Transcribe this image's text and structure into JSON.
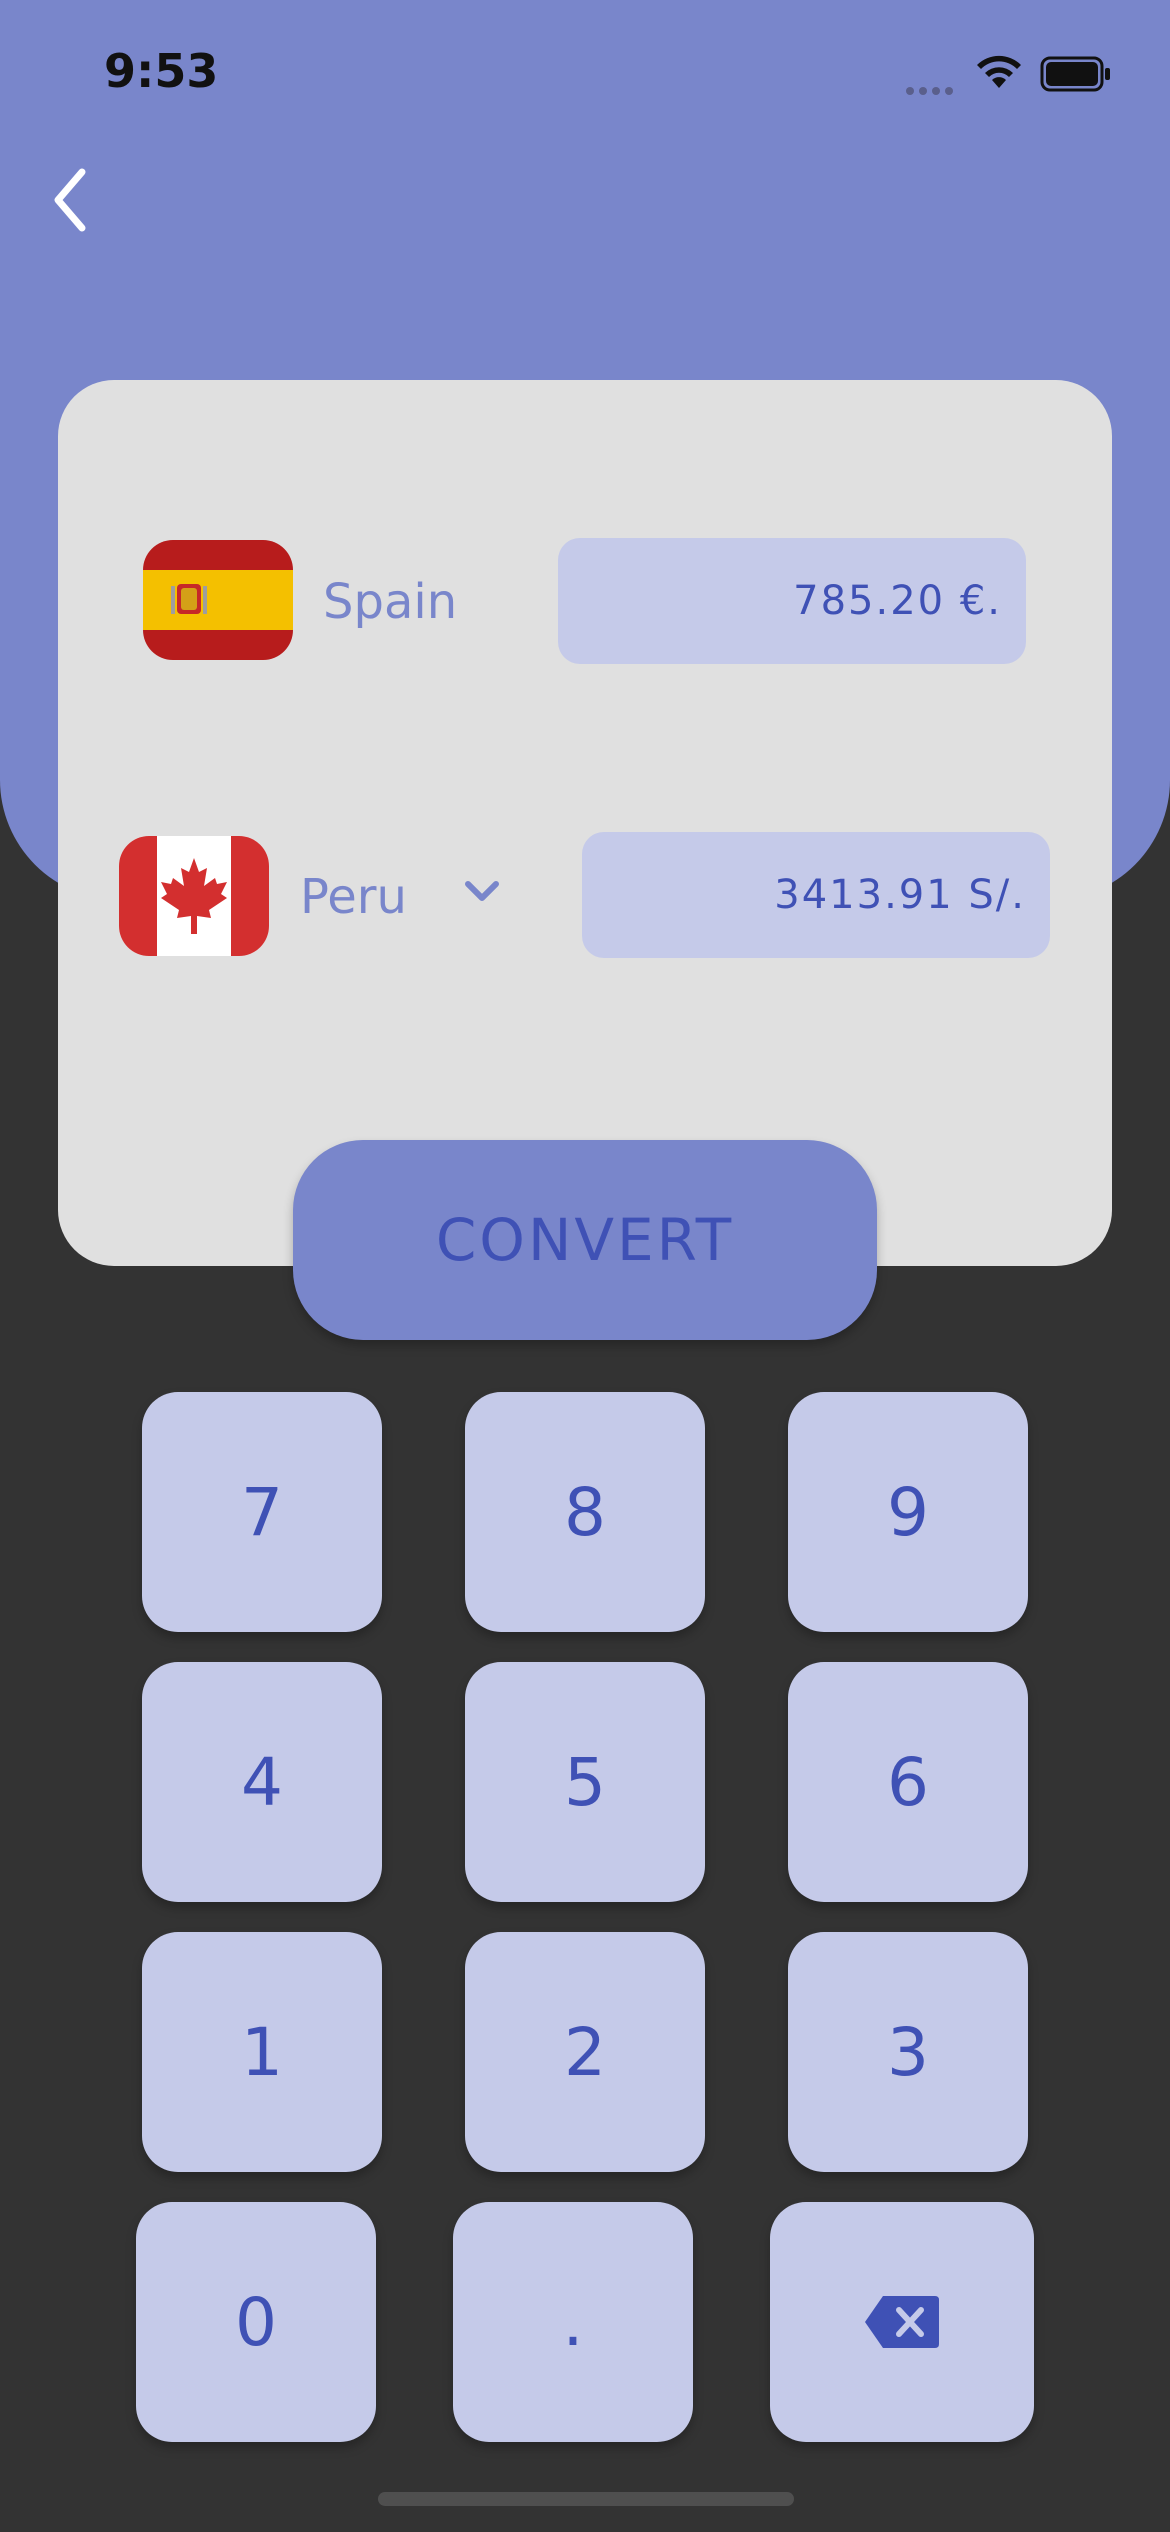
{
  "status_bar": {
    "time": "9:53"
  },
  "from": {
    "country": "Spain",
    "flag_icon": "spain-flag-icon",
    "amount": "785.20 €."
  },
  "to": {
    "country": "Peru",
    "flag_icon": "canada-flag-icon",
    "amount": "3413.91 S/."
  },
  "convert_label": "CONVERT",
  "keypad": {
    "k7": "7",
    "k8": "8",
    "k9": "9",
    "k4": "4",
    "k5": "5",
    "k6": "6",
    "k1": "1",
    "k2": "2",
    "k3": "3",
    "k0": "0",
    "kdot": ".",
    "backspace_icon": "backspace-icon"
  },
  "colors": {
    "accent": "#7986CB",
    "accent_dark": "#3F51B5",
    "field_bg": "#C5CAE9",
    "card_bg": "#E0E0E0",
    "background": "#333333"
  }
}
